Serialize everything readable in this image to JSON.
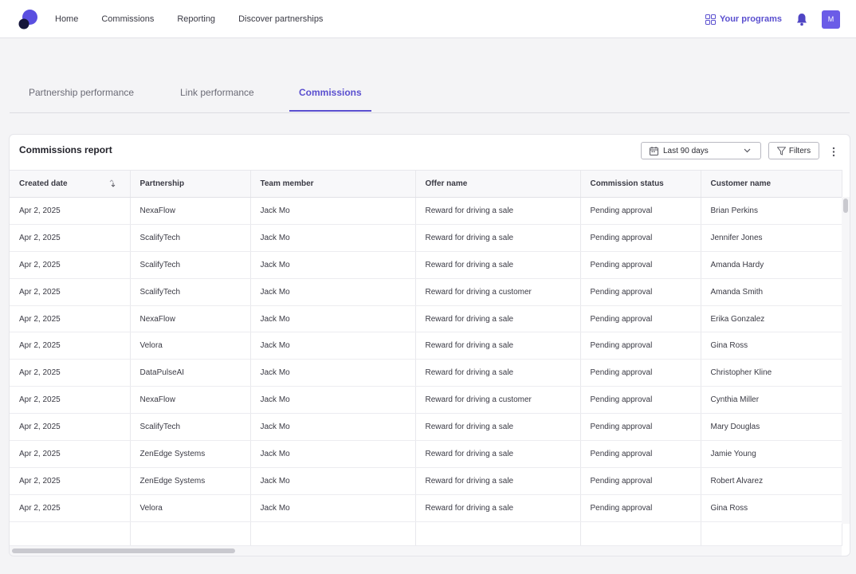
{
  "topnav": {
    "items": [
      "Home",
      "Commissions",
      "Reporting",
      "Discover partnerships"
    ],
    "programs_label": "Your programs",
    "avatar_initial": "M",
    "accent": "#5a4fcf"
  },
  "tabs": [
    "Partnership performance",
    "Link performance",
    "Commissions"
  ],
  "active_tab": "Commissions",
  "report": {
    "title": "Commissions report",
    "date_range": "Last 90 days",
    "filters_label": "Filters",
    "columns": [
      "Created date",
      "Partnership",
      "Team member",
      "Offer name",
      "Commission status",
      "Customer name"
    ],
    "rows": [
      [
        "Apr 2, 2025",
        "NexaFlow",
        "Jack Mo",
        "Reward for driving a sale",
        "Pending approval",
        "Brian Perkins"
      ],
      [
        "Apr 2, 2025",
        "ScalifyTech",
        "Jack Mo",
        "Reward for driving a sale",
        "Pending approval",
        "Jennifer Jones"
      ],
      [
        "Apr 2, 2025",
        "ScalifyTech",
        "Jack Mo",
        "Reward for driving a sale",
        "Pending approval",
        "Amanda Hardy"
      ],
      [
        "Apr 2, 2025",
        "ScalifyTech",
        "Jack Mo",
        "Reward for driving a customer",
        "Pending approval",
        "Amanda Smith"
      ],
      [
        "Apr 2, 2025",
        "NexaFlow",
        "Jack Mo",
        "Reward for driving a sale",
        "Pending approval",
        "Erika Gonzalez"
      ],
      [
        "Apr 2, 2025",
        "Velora",
        "Jack Mo",
        "Reward for driving a sale",
        "Pending approval",
        "Gina Ross"
      ],
      [
        "Apr 2, 2025",
        "DataPulseAI",
        "Jack Mo",
        "Reward for driving a sale",
        "Pending approval",
        "Christopher Kline"
      ],
      [
        "Apr 2, 2025",
        "NexaFlow",
        "Jack Mo",
        "Reward for driving a customer",
        "Pending approval",
        "Cynthia Miller"
      ],
      [
        "Apr 2, 2025",
        "ScalifyTech",
        "Jack Mo",
        "Reward for driving a sale",
        "Pending approval",
        "Mary Douglas"
      ],
      [
        "Apr 2, 2025",
        "ZenEdge Systems",
        "Jack Mo",
        "Reward for driving a sale",
        "Pending approval",
        "Jamie Young"
      ],
      [
        "Apr 2, 2025",
        "ZenEdge Systems",
        "Jack Mo",
        "Reward for driving a sale",
        "Pending approval",
        "Robert Alvarez"
      ],
      [
        "Apr 2, 2025",
        "Velora",
        "Jack Mo",
        "Reward for driving a sale",
        "Pending approval",
        "Gina Ross"
      ]
    ]
  }
}
